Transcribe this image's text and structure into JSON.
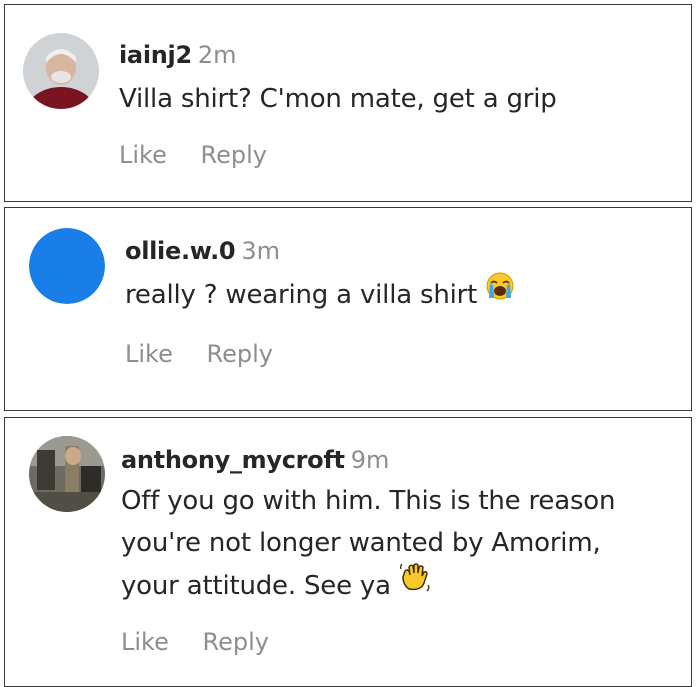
{
  "comments": [
    {
      "username": "iainj2",
      "time": "2m",
      "text": "Villa shirt? C'mon mate, get a grip",
      "like_label": "Like",
      "reply_label": "Reply",
      "avatar": "user-photo-avatar"
    },
    {
      "username": "ollie.w.0",
      "time": "3m",
      "text": "really ? wearing a villa shirt",
      "emoji": "loudly-crying-face-emoji",
      "like_label": "Like",
      "reply_label": "Reply",
      "avatar": "blue-circle-avatar",
      "avatar_color": "#1a7ee8"
    },
    {
      "username": "anthony_mycroft",
      "time": "9m",
      "text_lines": [
        "Off you go with him. This is the reason",
        "you're not longer wanted by Amorim,",
        "your attitude. See ya"
      ],
      "emoji": "waving-hand-emoji",
      "like_label": "Like",
      "reply_label": "Reply",
      "avatar": "user-photo-avatar"
    }
  ],
  "colors": {
    "username": "#262626",
    "meta": "#8e8e8e",
    "border": "#3a3a3a"
  }
}
